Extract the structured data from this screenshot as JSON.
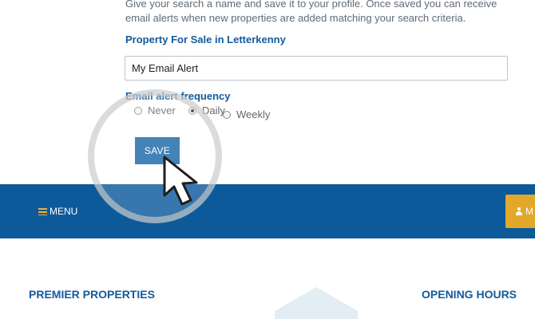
{
  "form": {
    "intro_text": "Give your search a name and save it to your profile. Once saved you can receive email alerts when new properties are added matching your search criteria.",
    "section_title": "Property For Sale in Letterkenny",
    "alert_name_value": "My Email Alert",
    "frequency_label": "Email alert frequency",
    "frequency_options": [
      {
        "label": "Never",
        "selected": false
      },
      {
        "label": "Daily",
        "selected": true
      },
      {
        "label": "Weekly",
        "selected": false
      }
    ],
    "save_label": "SAVE"
  },
  "nav": {
    "menu_label": "MENU",
    "account_label": "M"
  },
  "footer": {
    "left_heading": "PREMIER PROPERTIES",
    "right_heading": "OPENING HOURS"
  },
  "colors": {
    "brand_blue": "#0d5a9b",
    "heading_blue": "#135a9c",
    "button_blue": "#1b68a8",
    "accent_gold": "#e2a82a"
  },
  "icons": {
    "menu": "hamburger-icon",
    "account": "person-icon",
    "cursor": "mouse-pointer-icon"
  }
}
